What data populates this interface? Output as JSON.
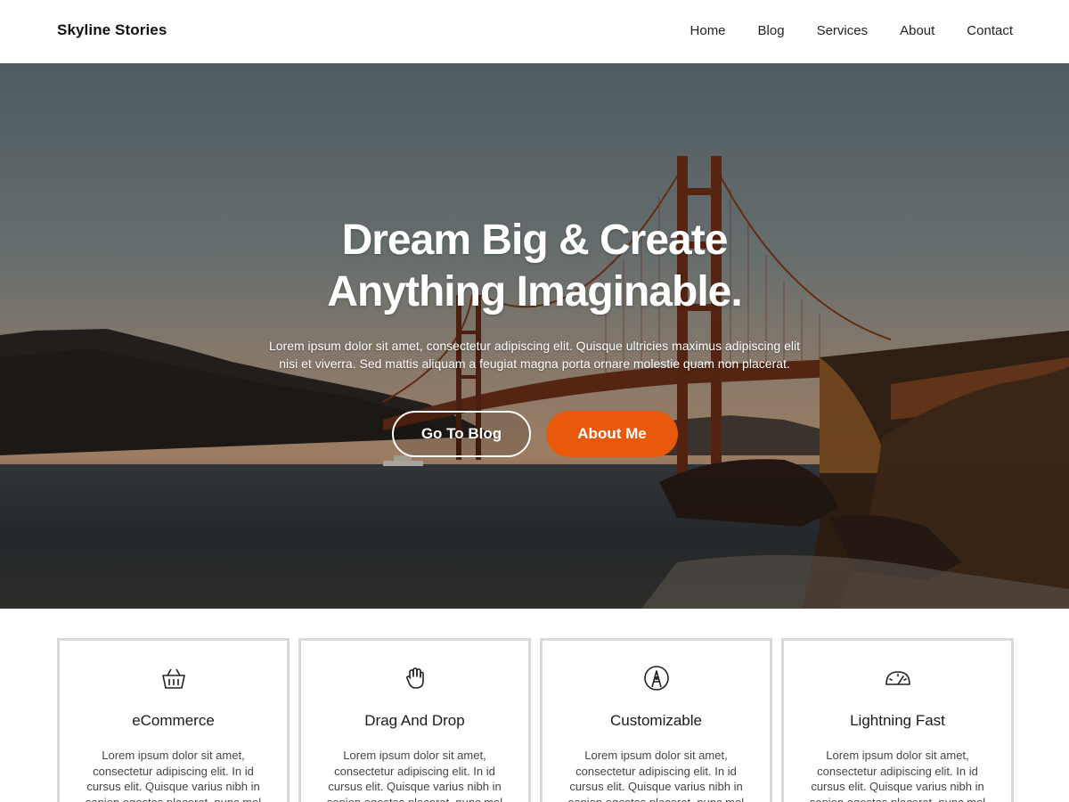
{
  "site": {
    "brand": "Skyline Stories"
  },
  "nav": {
    "items": [
      "Home",
      "Blog",
      "Services",
      "About",
      "Contact"
    ]
  },
  "hero": {
    "title_line1": "Dream Big & Create",
    "title_line2": "Anything Imaginable.",
    "text": "Lorem ipsum dolor sit amet, consectetur adipiscing elit. Quisque ultricies maximus adipiscing elit nisi et viverra. Sed mattis aliquam a feugiat magna porta ornare molestie quam non placerat.",
    "button_primary": "Go To Blog",
    "button_secondary": "About Me",
    "accent_color": "#e8590c"
  },
  "features": [
    {
      "icon": "basket-icon",
      "title": "eCommerce",
      "text": "Lorem ipsum dolor sit amet, consectetur adipiscing elit. In id cursus elit. Quisque varius nibh in sapien egestas placerat, nunc mol"
    },
    {
      "icon": "hand-icon",
      "title": "Drag And Drop",
      "text": "Lorem ipsum dolor sit amet, consectetur adipiscing elit. In id cursus elit. Quisque varius nibh in sapien egestas placerat, nunc mol"
    },
    {
      "icon": "pen-circle-icon",
      "title": "Customizable",
      "text": "Lorem ipsum dolor sit amet, consectetur adipiscing elit. In id cursus elit. Quisque varius nibh in sapien egestas placerat, nunc mol"
    },
    {
      "icon": "speedometer-icon",
      "title": "Lightning Fast",
      "text": "Lorem ipsum dolor sit amet, consectetur adipiscing elit. In id cursus elit. Quisque varius nibh in sapien egestas placerat, nunc mol"
    }
  ]
}
